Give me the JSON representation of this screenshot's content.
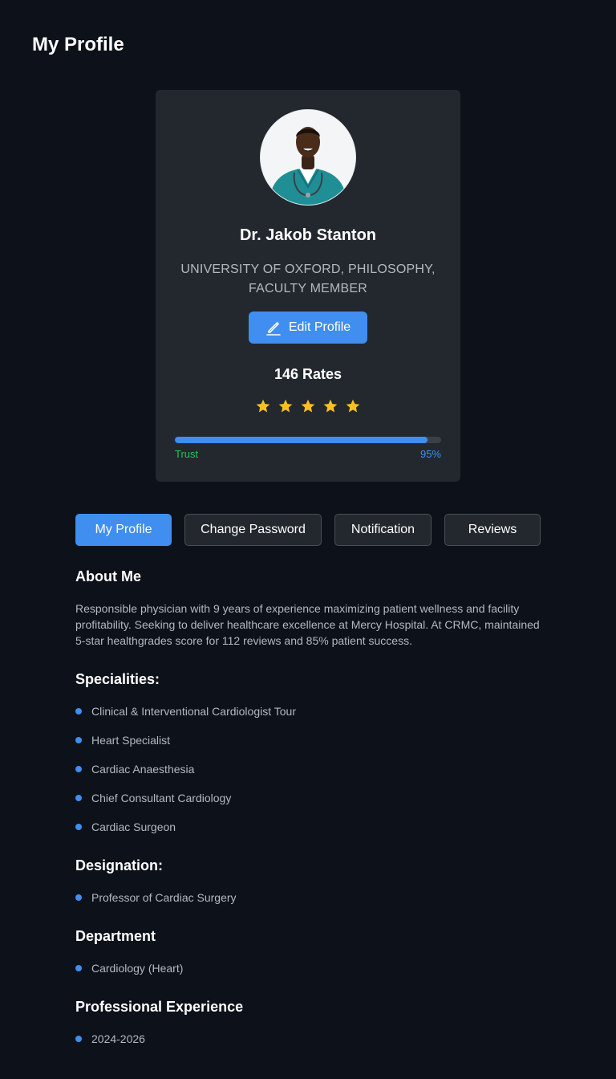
{
  "page": {
    "title": "My Profile"
  },
  "profile": {
    "name": "Dr. Jakob Stanton",
    "affiliation": "UNIVERSITY OF OXFORD, PHILOSOPHY, FACULTY MEMBER",
    "edit_label": "Edit Profile",
    "edit_icon": "pencil-icon",
    "rates": "146 Rates",
    "rating": 5,
    "rating_max": 5,
    "trust": {
      "label": "Trust",
      "value": "95%",
      "fraction": 0.95
    }
  },
  "tabs": [
    {
      "label": "My Profile",
      "active": true
    },
    {
      "label": "Change Password",
      "active": false
    },
    {
      "label": "Notification",
      "active": false
    },
    {
      "label": "Reviews",
      "active": false
    }
  ],
  "about": {
    "title": "About Me",
    "text": "Responsible physician with 9 years of experience maximizing patient wellness and facility profitability. Seeking to deliver healthcare excellence at Mercy Hospital. At CRMC, maintained 5-star healthgrades score for 112 reviews and 85% patient success."
  },
  "specialities": {
    "title": "Specialities:",
    "items": [
      "Clinical & Interventional Cardiologist  Tour",
      "Heart Specialist",
      "Cardiac Anaesthesia",
      "Chief Consultant Cardiology",
      "Cardiac Surgeon"
    ]
  },
  "designation": {
    "title": "Designation:",
    "items": [
      "Professor of Cardiac Surgery"
    ]
  },
  "department": {
    "title": "Department",
    "items": [
      "Cardiology (Heart)"
    ]
  },
  "experience": {
    "title": "Professional Experience",
    "items": [
      "2024-2026"
    ]
  },
  "colors": {
    "background": "#0d111a",
    "card": "#23282f",
    "accent": "#3f8ef0",
    "star": "#fbbf24",
    "trust_label": "#22c55e"
  }
}
